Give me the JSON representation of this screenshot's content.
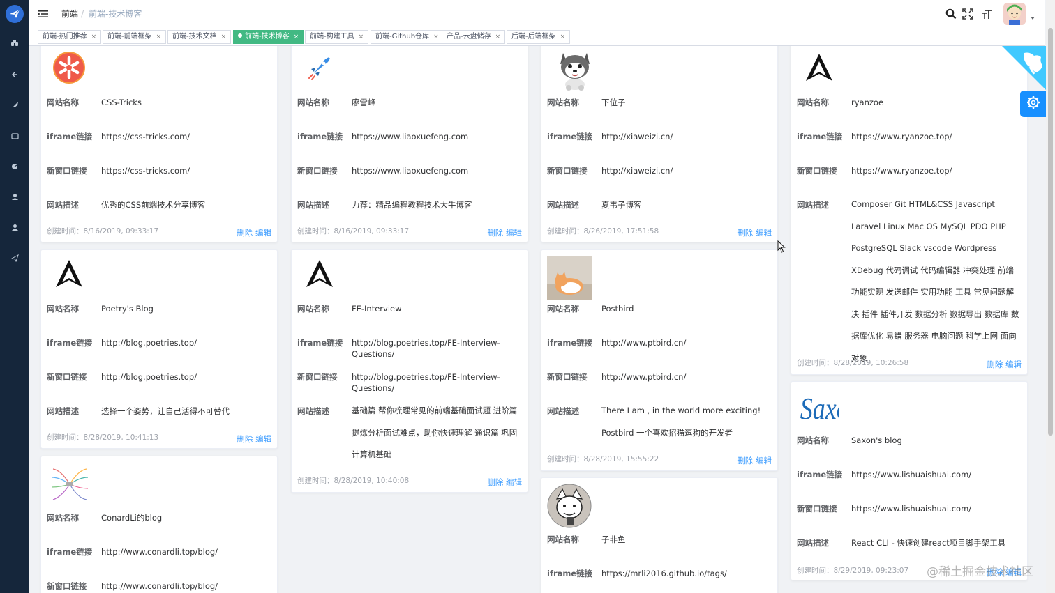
{
  "breadcrumb": {
    "first": "前端",
    "sep": "/",
    "current": "前端-技术博客"
  },
  "tags": [
    {
      "label": "前端-热门推荐",
      "active": false
    },
    {
      "label": "前端-前端框架",
      "active": false
    },
    {
      "label": "前端-技术文档",
      "active": false
    },
    {
      "label": "前端-技术博客",
      "active": true
    },
    {
      "label": "前端-构建工具",
      "active": false
    },
    {
      "label": "前端-Github仓库",
      "active": false
    },
    {
      "label": "产品-云盘储存",
      "active": false
    },
    {
      "label": "后端-后端框架",
      "active": false
    }
  ],
  "tag_close": "×",
  "labels": {
    "name": "网站名称",
    "iframe": "iframe链接",
    "newwin": "新窗口链接",
    "desc": "网站描述"
  },
  "actions": {
    "delete": "删除",
    "edit": "编辑"
  },
  "cards": [
    {
      "icon": "asterisk-logo-icon",
      "name": "CSS-Tricks",
      "iframe": "https://css-tricks.com/",
      "newwin": "https://css-tricks.com/",
      "desc": "优秀的CSS前端技术分享博客",
      "time": "创建时间：8/16/2019, 09:33:17"
    },
    {
      "icon": "rocket-icon",
      "name": "廖雪峰",
      "iframe": "https://www.liaoxuefeng.com",
      "newwin": "https://www.liaoxuefeng.com",
      "desc": "力荐：精品编程教程技术大牛博客",
      "time": "创建时间：8/16/2019, 09:33:17"
    },
    {
      "icon": "husky-dog-icon",
      "name": "下位子",
      "iframe": "http://xiaweizi.cn/",
      "newwin": "http://xiaweizi.cn/",
      "desc": "夏韦子博客",
      "time": "创建时间：8/26/2019, 17:51:58"
    },
    {
      "icon": "ryanzoe-logo-icon",
      "name": "ryanzoe",
      "iframe": "https://www.ryanzoe.top/",
      "newwin": "https://www.ryanzoe.top/",
      "desc": "Composer Git HTML&CSS Javascript Laravel Linux Mac OS MySQL PDO PHP PostgreSQL Slack vscode Wordpress XDebug 代码调试 代码编辑器 冲突处理 前端 功能实现 发送邮件 实用功能 工具 常见问题解决 插件 插件开发 数据分析 数据导出 数据库 数据库优化 易错 服务器 电脑问题 科学上网 面向对象",
      "time": "创建时间：8/28/2019, 10:26:58"
    },
    {
      "icon": "poetry-logo-icon",
      "name": "Poetry's Blog",
      "iframe": "http://blog.poetries.top/",
      "newwin": "http://blog.poetries.top/",
      "desc": "选择一个姿势，让自己活得不可替代",
      "time": "创建时间：8/28/2019, 10:41:13"
    },
    {
      "icon": "fe-interview-logo-icon",
      "name": "FE-Interview",
      "iframe": "http://blog.poetries.top/FE-Interview-Questions/",
      "newwin": "http://blog.poetries.top/FE-Interview-Questions/",
      "desc": "基础篇 帮你梳理常见的前端基础面试题 进阶篇 提炼分析面试难点，助你快速理解 通识篇 巩固计算机基础",
      "time": "创建时间：8/28/2019, 10:40:08"
    },
    {
      "icon": "cat-photo-icon",
      "name": "Postbird",
      "iframe": "http://www.ptbird.cn/",
      "newwin": "http://www.ptbird.cn/",
      "desc": "There I am , in the world more exciting! Postbird 一个喜欢招猫逗狗的开发者",
      "time": "创建时间：8/28/2019, 15:55:22"
    },
    {
      "icon": "saxon-logo-icon",
      "name": "Saxon's blog",
      "iframe": "https://www.lishuaishuai.com/",
      "newwin": "https://www.lishuaishuai.com/",
      "desc": "React CLI - 快速创建react项目脚手架工具",
      "time": "创建时间：8/29/2019, 09:23:07"
    },
    {
      "icon": "mindmap-icon",
      "name": "ConardLi的blog",
      "iframe": "http://www.conardli.top/blog/",
      "newwin": "http://www.conardli.top/blog/",
      "desc": "",
      "time": ""
    },
    {
      "icon": "cartoon-avatar-icon",
      "name": "子非鱼",
      "iframe": "https://mrli2016.github.io/tags/",
      "newwin": "",
      "desc": "",
      "time": ""
    }
  ],
  "watermark": "@稀土掘金技术社区",
  "colors": {
    "sidebar": "#15263b",
    "accent": "#42b983",
    "link": "#409eff",
    "settings": "#1890ff"
  }
}
